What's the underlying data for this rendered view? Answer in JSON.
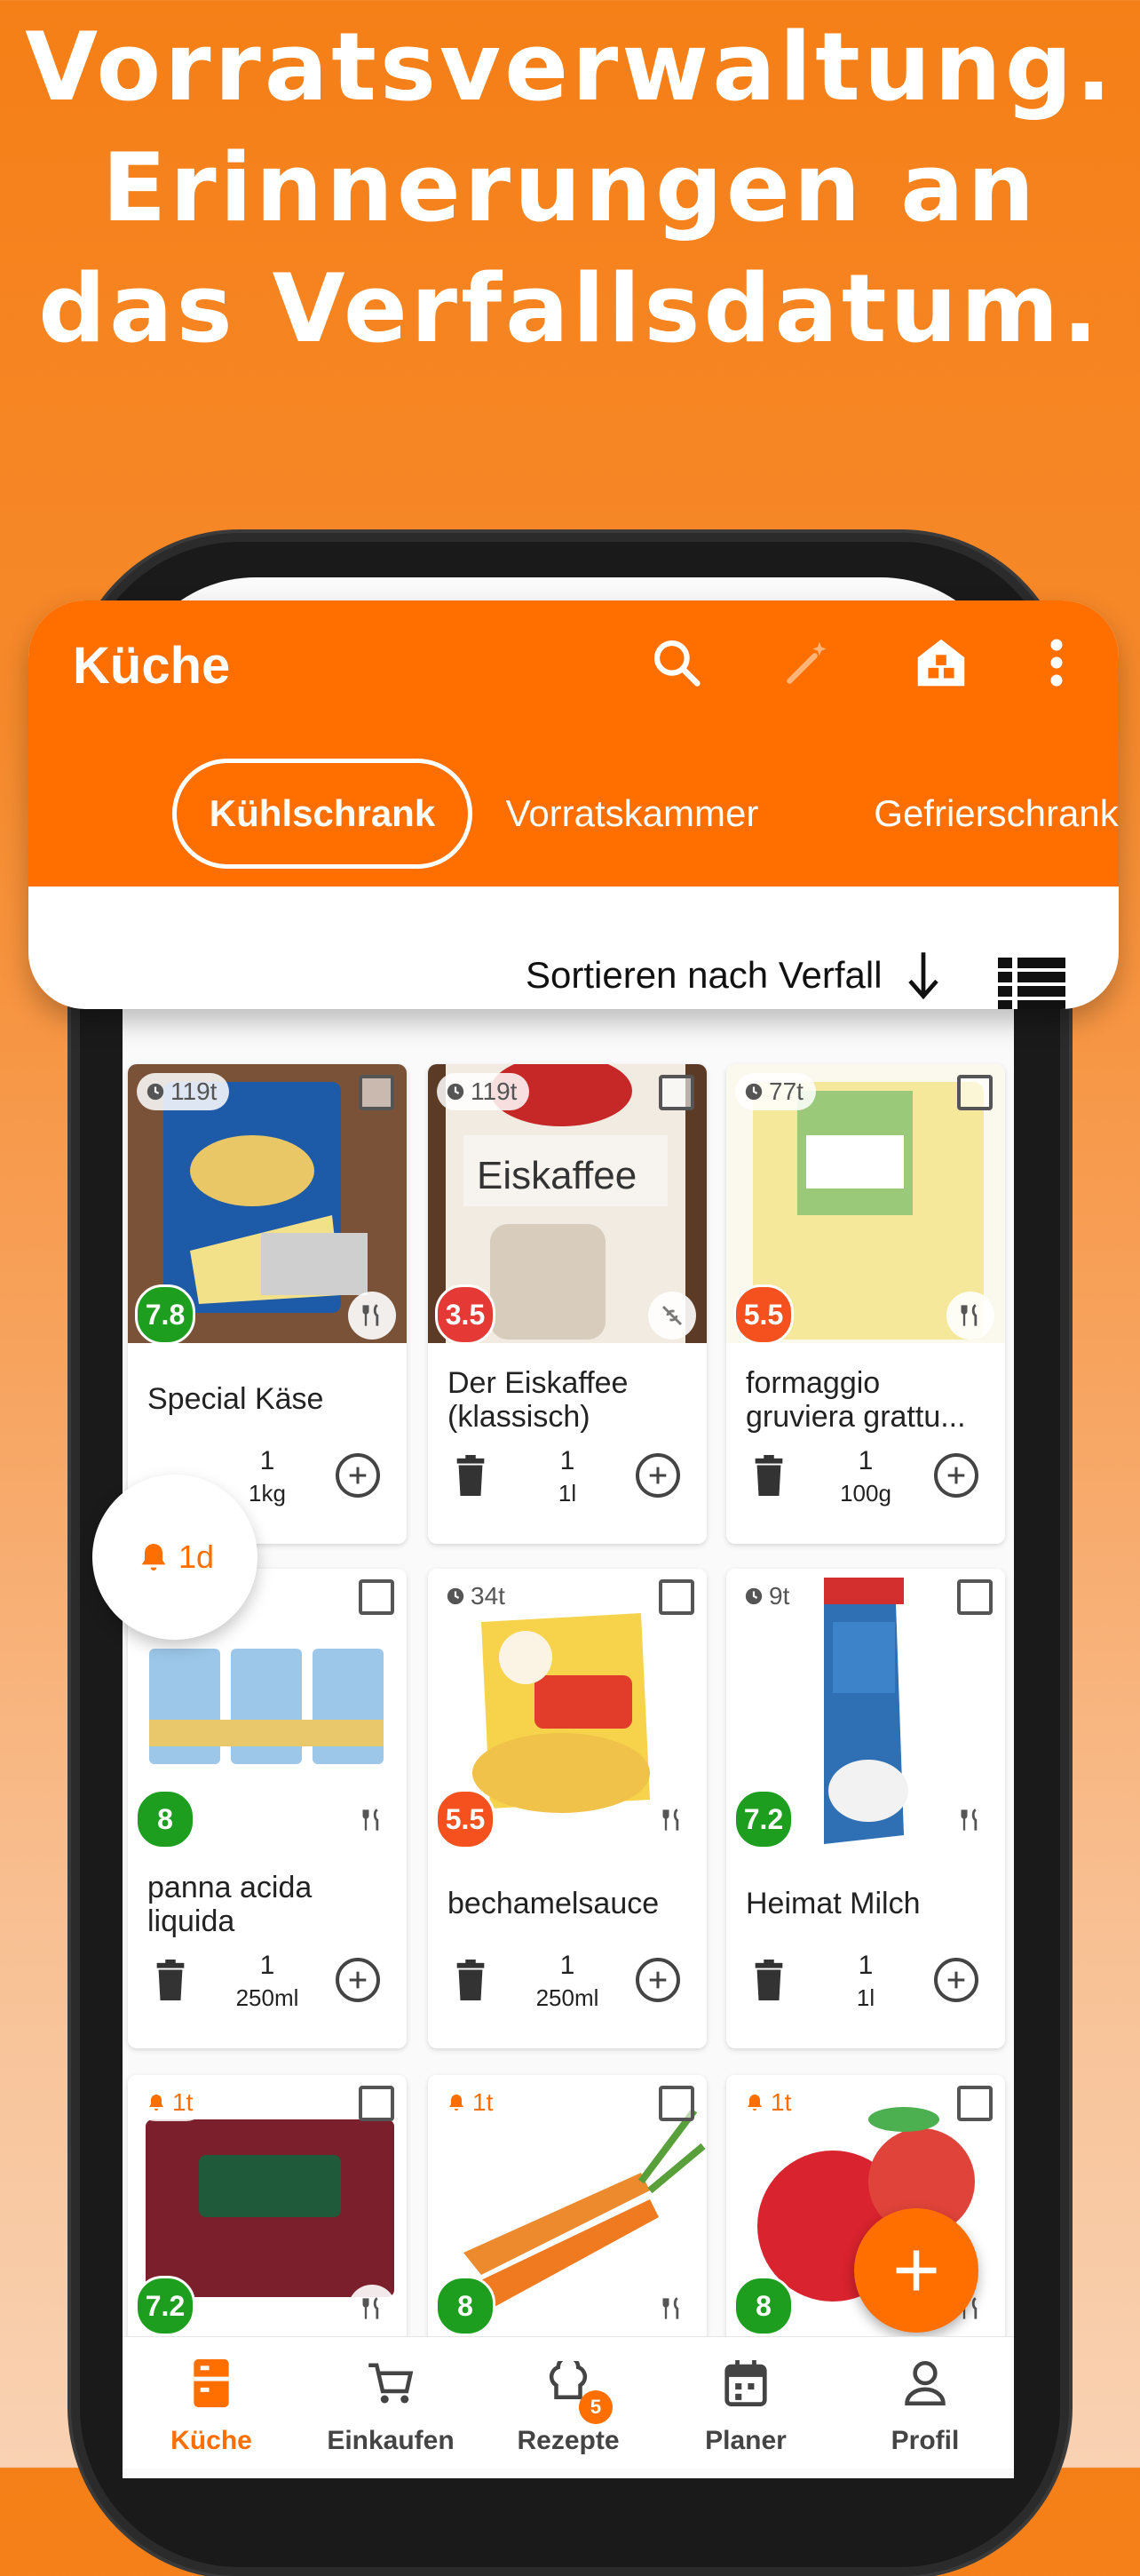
{
  "headline": {
    "line1": "Vorratsverwaltung.",
    "line2": "Erinnerungen an",
    "line3": "das Verfallsdatum."
  },
  "app": {
    "title": "Küche",
    "accent": "#FF6F00"
  },
  "header_icons": [
    "search-icon",
    "magic-wand-icon",
    "house-icon",
    "more-vert-icon"
  ],
  "tabs": [
    {
      "label": "Kühlschrank",
      "active": true
    },
    {
      "label": "Vorratskammer",
      "active": false
    },
    {
      "label": "Gefrierschrank",
      "active": false
    }
  ],
  "sort": {
    "label": "Sortieren nach Verfall"
  },
  "items": [
    {
      "name": "Special Käse",
      "days": "119t",
      "score": "7.8",
      "score_color": "#1E9E1E",
      "qty": "1",
      "unit": "1kg"
    },
    {
      "name": "Der Eiskaffee (klassisch)",
      "days": "119t",
      "score": "3.5",
      "score_color": "#E53935",
      "qty": "1",
      "unit": "1l"
    },
    {
      "name": "formaggio gruviera grattu...",
      "days": "77t",
      "score": "5.5",
      "score_color": "#F4511E",
      "qty": "1",
      "unit": "100g"
    },
    {
      "name": "panna acida liquida",
      "days": "",
      "score": "8",
      "score_color": "#1E9E1E",
      "qty": "1",
      "unit": "250ml"
    },
    {
      "name": "bechamelsauce",
      "days": "34t",
      "score": "5.5",
      "score_color": "#F4511E",
      "qty": "1",
      "unit": "250ml"
    },
    {
      "name": "Heimat Milch",
      "days": "9t",
      "score": "7.2",
      "score_color": "#1E9E1E",
      "qty": "1",
      "unit": "1l"
    },
    {
      "name": "",
      "days": "1t",
      "score": "7.2",
      "score_color": "#1E9E1E",
      "qty": "",
      "unit": ""
    },
    {
      "name": "",
      "days": "1t",
      "score": "8",
      "score_color": "#1E9E1E",
      "qty": "",
      "unit": ""
    },
    {
      "name": "",
      "days": "1t",
      "score": "8",
      "score_color": "#1E9E1E",
      "qty": "",
      "unit": ""
    }
  ],
  "reminder": {
    "label": "1d"
  },
  "nav": [
    {
      "label": "Küche",
      "icon": "kitchen-icon",
      "active": true
    },
    {
      "label": "Einkaufen",
      "icon": "cart-icon",
      "active": false
    },
    {
      "label": "Rezepte",
      "icon": "chef-hat-icon",
      "active": false,
      "badge": "5"
    },
    {
      "label": "Planer",
      "icon": "calendar-icon",
      "active": false
    },
    {
      "label": "Profil",
      "icon": "person-icon",
      "active": false
    }
  ]
}
